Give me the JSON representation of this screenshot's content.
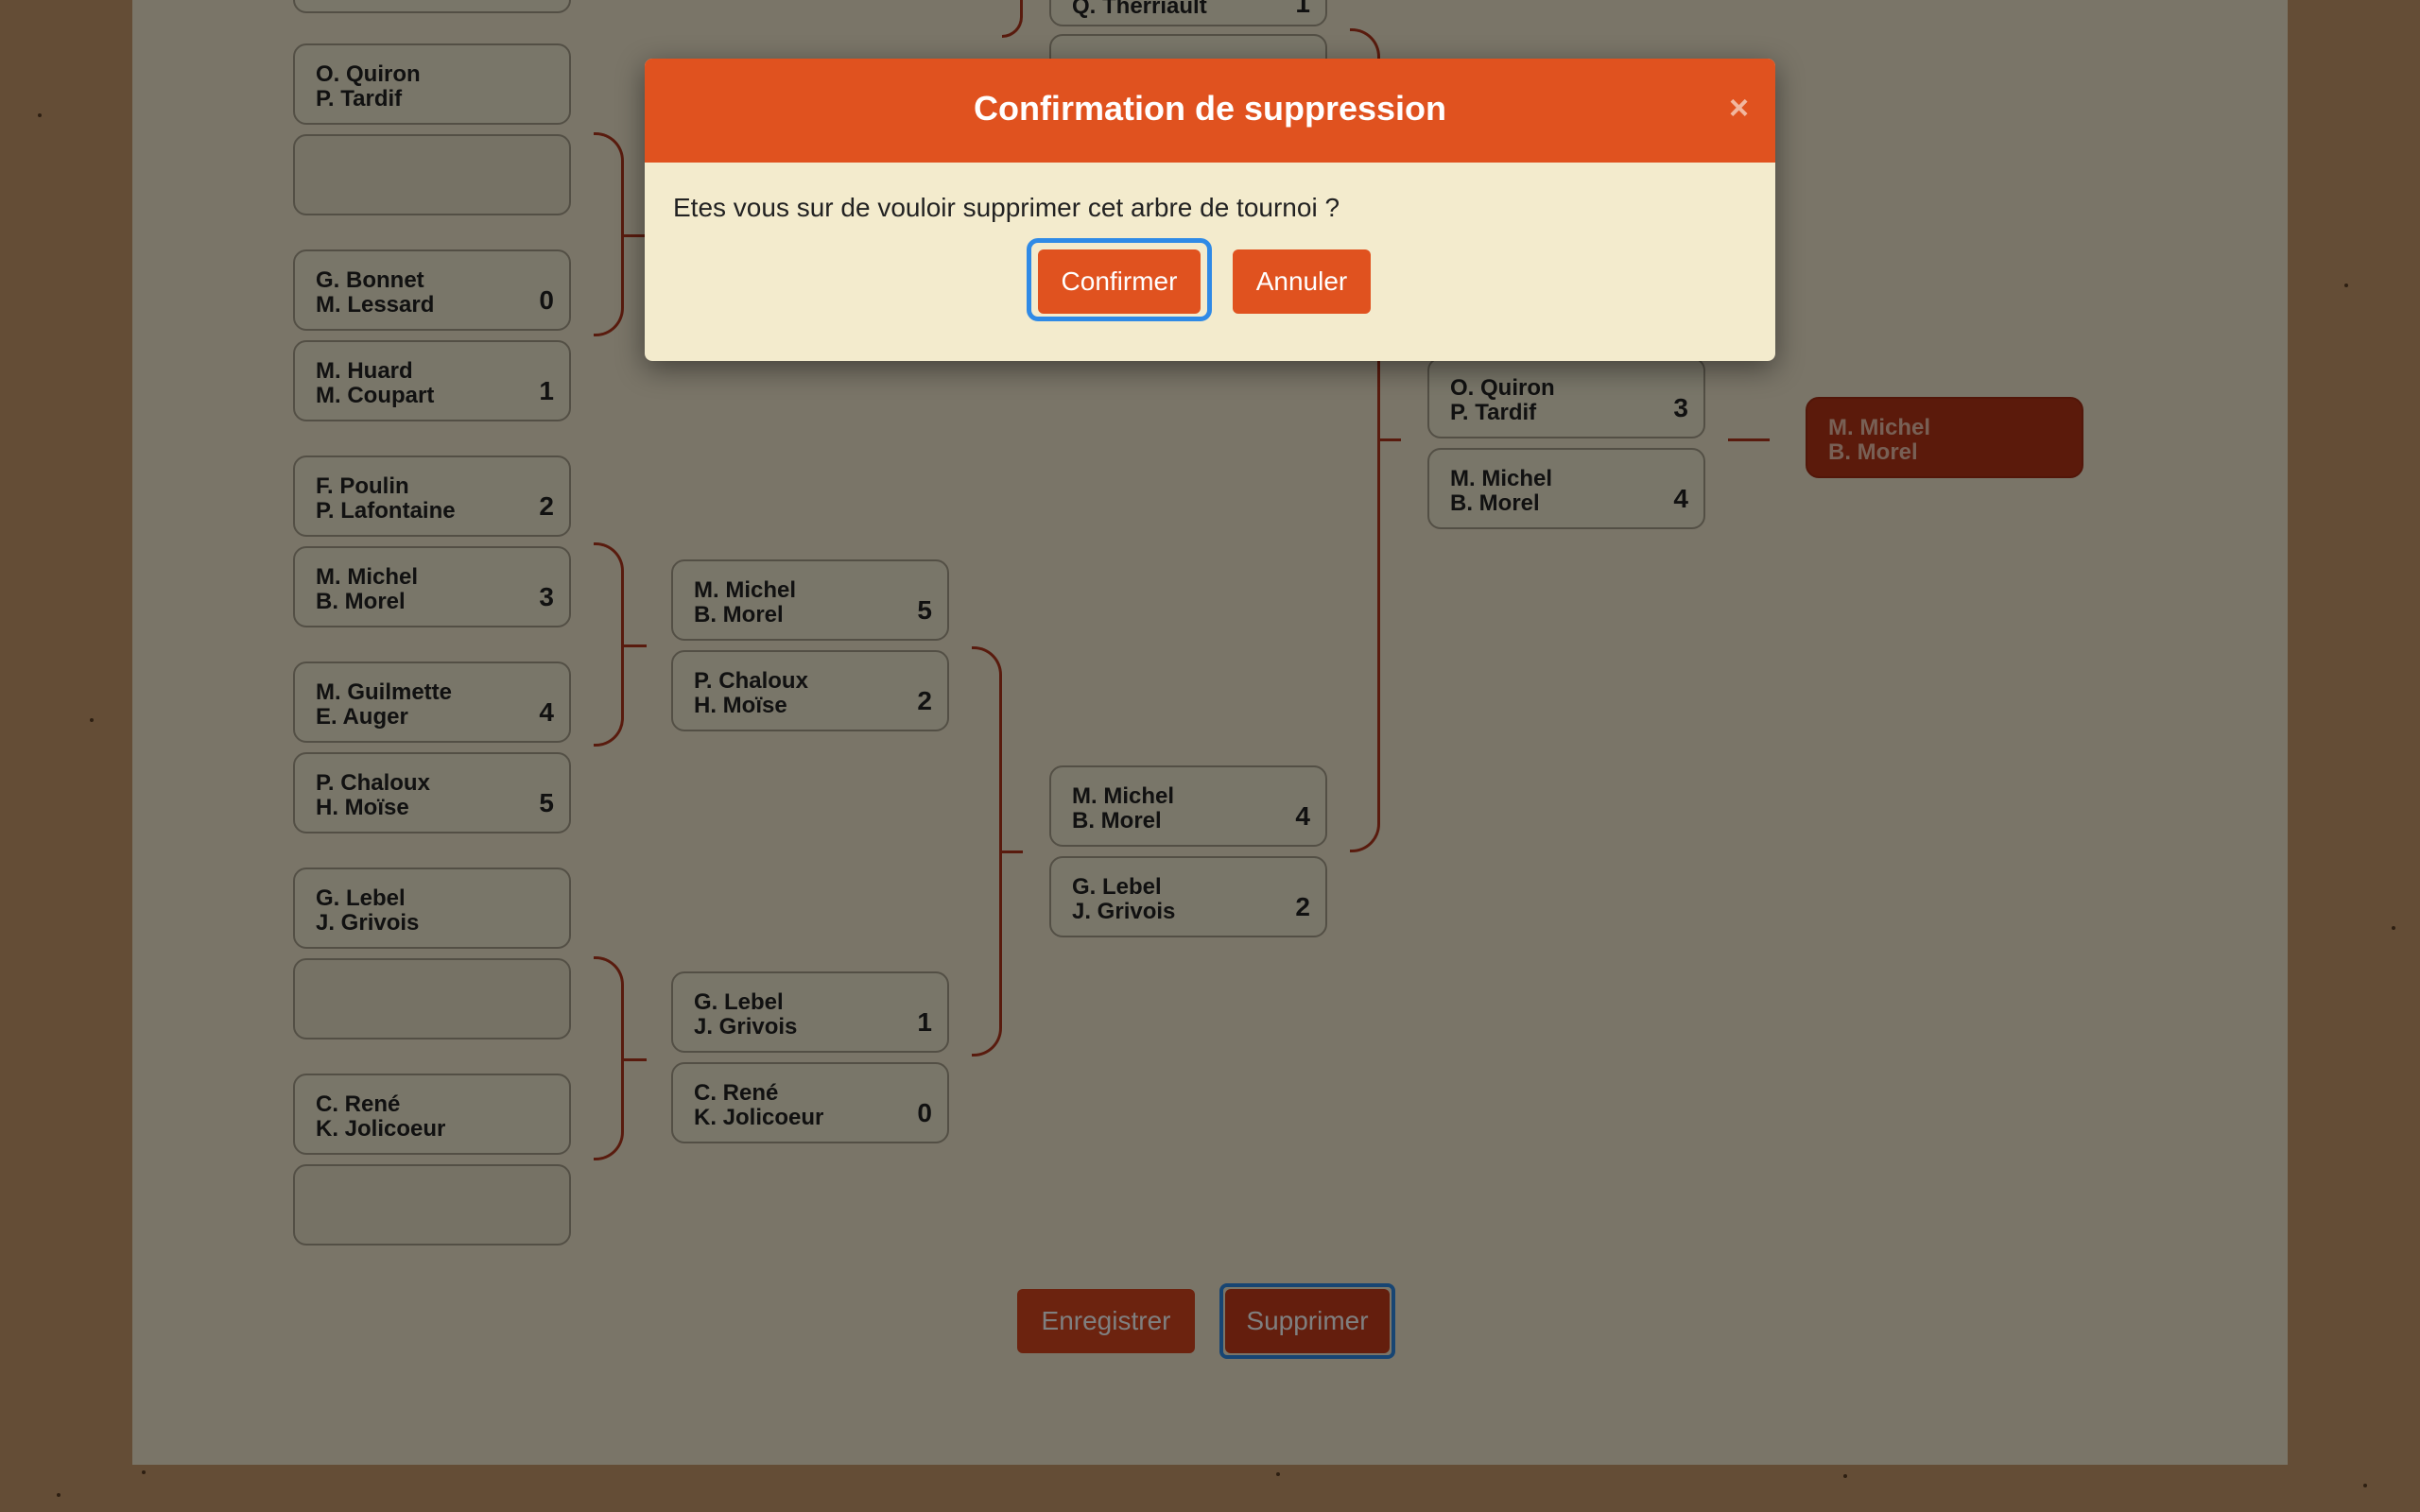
{
  "bracket": {
    "round1": [
      {
        "top": {
          "names": [
            "O. Quiron",
            "P. Tardif"
          ],
          "score": ""
        },
        "bottom": {
          "names": [],
          "score": ""
        }
      },
      {
        "top": {
          "names": [
            "G. Bonnet",
            "M. Lessard"
          ],
          "score": "0"
        },
        "bottom": {
          "names": [
            "M. Huard",
            "M. Coupart"
          ],
          "score": "1"
        }
      },
      {
        "top": {
          "names": [
            "F. Poulin",
            "P. Lafontaine"
          ],
          "score": "2"
        },
        "bottom": {
          "names": [
            "M. Michel",
            "B. Morel"
          ],
          "score": "3"
        }
      },
      {
        "top": {
          "names": [
            "M. Guilmette",
            "E. Auger"
          ],
          "score": "4"
        },
        "bottom": {
          "names": [
            "P. Chaloux",
            "H. Moïse"
          ],
          "score": "5"
        }
      },
      {
        "top": {
          "names": [
            "G. Lebel",
            "J. Grivois"
          ],
          "score": ""
        },
        "bottom": {
          "names": [],
          "score": ""
        }
      },
      {
        "top": {
          "names": [
            "C. René",
            "K. Jolicoeur"
          ],
          "score": ""
        },
        "bottom": {
          "names": [],
          "score": ""
        }
      }
    ],
    "round2": [
      {
        "top": {
          "names": [
            "M. Michel",
            "B. Morel"
          ],
          "score": "5"
        },
        "bottom": {
          "names": [
            "P. Chaloux",
            "H. Moïse"
          ],
          "score": "2"
        }
      },
      {
        "top": {
          "names": [
            "G. Lebel",
            "J. Grivois"
          ],
          "score": "1"
        },
        "bottom": {
          "names": [
            "C. René",
            "K. Jolicoeur"
          ],
          "score": "0"
        }
      }
    ],
    "round3": [
      {
        "top": {
          "names": [
            "Q. Therriault",
            ""
          ],
          "score": "1"
        }
      },
      {
        "top": {
          "names": [
            "M. Michel",
            "B. Morel"
          ],
          "score": "4"
        },
        "bottom": {
          "names": [
            "G. Lebel",
            "J. Grivois"
          ],
          "score": "2"
        }
      }
    ],
    "round4": [
      {
        "top": {
          "names": [
            "O. Quiron",
            "P. Tardif"
          ],
          "score": "3"
        },
        "bottom": {
          "names": [
            "M. Michel",
            "B. Morel"
          ],
          "score": "4"
        }
      }
    ],
    "winner": {
      "names": [
        "M. Michel",
        "B. Morel"
      ]
    }
  },
  "actions": {
    "save_label": "Enregistrer",
    "delete_label": "Supprimer"
  },
  "modal": {
    "title": "Confirmation de suppression",
    "close_glyph": "×",
    "message": "Etes vous sur de vouloir supprimer cet arbre de tournoi ?",
    "confirm_label": "Confirmer",
    "cancel_label": "Annuler"
  },
  "colors": {
    "accent": "#e0521f",
    "focus_ring": "#2f8ae6",
    "panel": "#f4ebd1",
    "background": "#c89b6c"
  }
}
